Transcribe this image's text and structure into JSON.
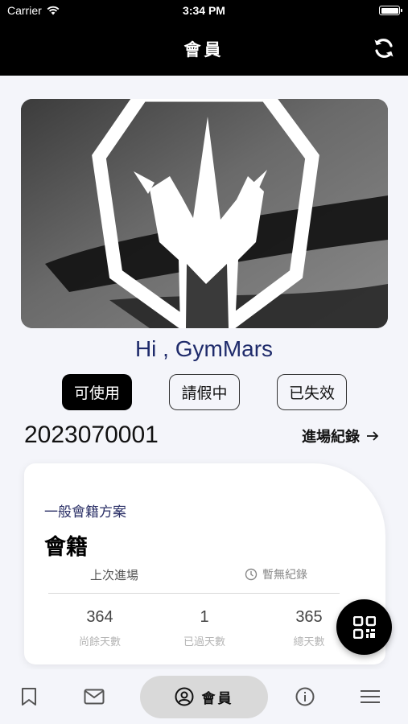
{
  "status_bar": {
    "carrier": "Carrier",
    "time": "3:34 PM"
  },
  "header": {
    "title": "會員"
  },
  "greeting": "Hi , GymMars",
  "status_pills": {
    "active": "可使用",
    "leave": "請假中",
    "expired": "已失效"
  },
  "member_id": "2023070001",
  "entry_record_link": "進場紀錄",
  "plan_card": {
    "subtitle": "一般會籍方案",
    "title": "會籍",
    "last_entry_label": "上次進場",
    "last_entry_value": "暫無紀錄",
    "stats": [
      {
        "value": "364",
        "label": "尚餘天數"
      },
      {
        "value": "1",
        "label": "已過天數"
      },
      {
        "value": "365",
        "label": "總天數"
      }
    ]
  },
  "tabbar": {
    "active_label": "會員"
  },
  "colors": {
    "header_bg": "#000000",
    "greeting": "#1f2b6b",
    "page_bg": "#f4f5fa",
    "accent": "#000000"
  }
}
